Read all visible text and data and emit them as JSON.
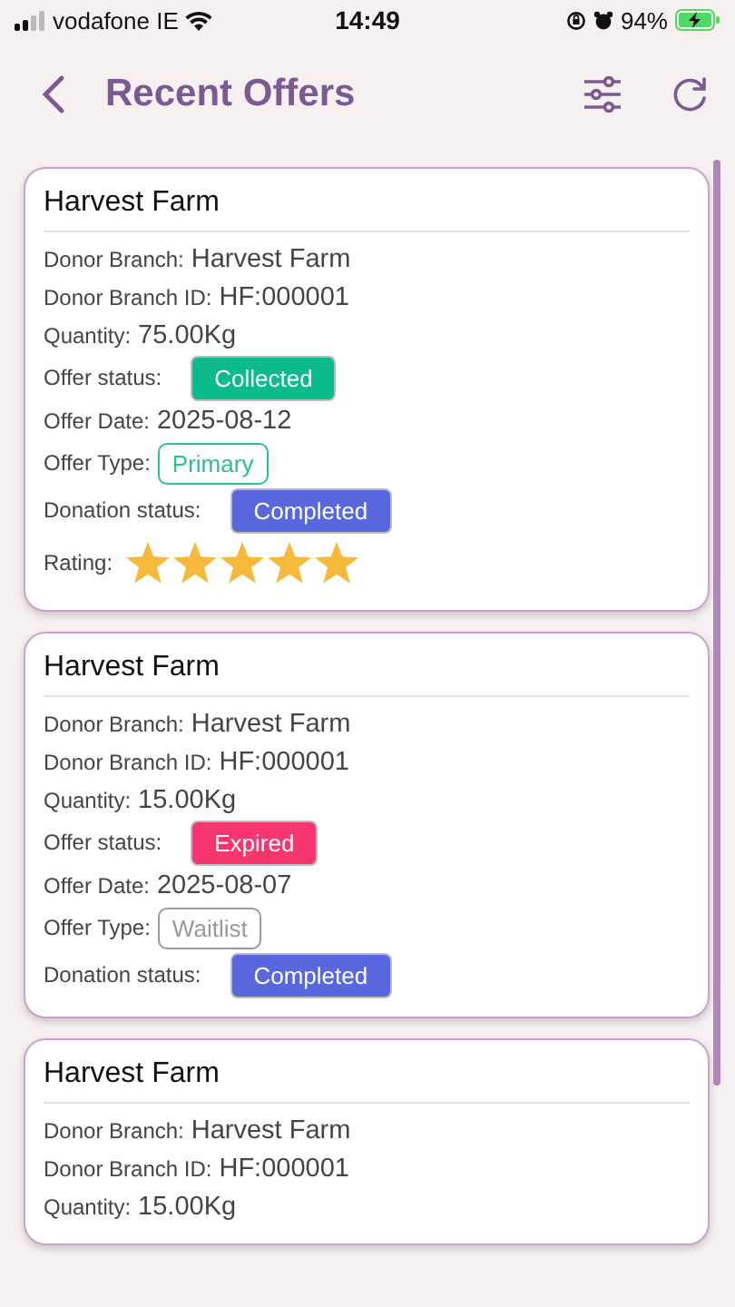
{
  "status_bar": {
    "carrier": "vodafone IE",
    "time": "14:49",
    "battery": "94%"
  },
  "header": {
    "title": "Recent Offers"
  },
  "cards": [
    {
      "title": "Harvest Farm",
      "fields": [
        {
          "kind": "text",
          "label": "Donor Branch:",
          "value": "Harvest Farm"
        },
        {
          "kind": "text",
          "label": "Donor Branch ID:",
          "value": "HF:000001"
        },
        {
          "kind": "text",
          "label": "Quantity:",
          "value": "75.00Kg"
        },
        {
          "kind": "badge",
          "label": "Offer status:",
          "value": "Collected",
          "color": "#0cbb8a"
        },
        {
          "kind": "text",
          "label": "Offer Date:",
          "value": "2025-08-12"
        },
        {
          "kind": "outline",
          "label": "Offer Type:",
          "value": "Primary",
          "color": "#2bbf91"
        },
        {
          "kind": "badge",
          "label": "Donation status:",
          "value": "Completed",
          "color": "#5867dd"
        },
        {
          "kind": "stars",
          "label": "Rating:",
          "stars": 5
        }
      ]
    },
    {
      "title": "Harvest Farm",
      "fields": [
        {
          "kind": "text",
          "label": "Donor Branch:",
          "value": "Harvest Farm"
        },
        {
          "kind": "text",
          "label": "Donor Branch ID:",
          "value": "HF:000001"
        },
        {
          "kind": "text",
          "label": "Quantity:",
          "value": "15.00Kg"
        },
        {
          "kind": "badge",
          "label": "Offer status:",
          "value": "Expired",
          "color": "#f7356e"
        },
        {
          "kind": "text",
          "label": "Offer Date:",
          "value": "2025-08-07"
        },
        {
          "kind": "outline",
          "label": "Offer Type:",
          "value": "Waitlist",
          "color": "#999999"
        },
        {
          "kind": "badge",
          "label": "Donation status:",
          "value": "Completed",
          "color": "#5867dd"
        }
      ]
    },
    {
      "title": "Harvest Farm",
      "fields": [
        {
          "kind": "text",
          "label": "Donor Branch:",
          "value": "Harvest Farm"
        },
        {
          "kind": "text",
          "label": "Donor Branch ID:",
          "value": "HF:000001"
        },
        {
          "kind": "text",
          "label": "Quantity:",
          "value": "15.00Kg"
        }
      ]
    }
  ]
}
